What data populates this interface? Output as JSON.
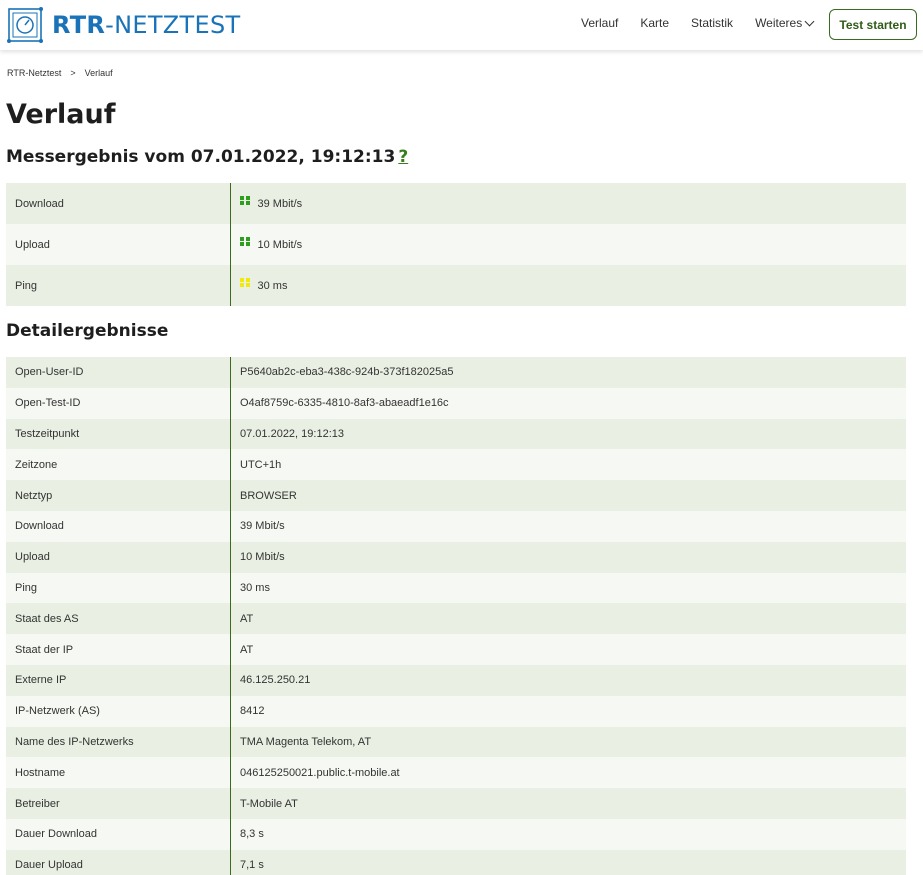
{
  "header": {
    "logo_bold": "RTR",
    "logo_rest": "-NETZTEST",
    "nav": [
      "Verlauf",
      "Karte",
      "Statistik",
      "Weiteres"
    ],
    "start_button": "Test starten"
  },
  "breadcrumb": {
    "home": "RTR-Netztest",
    "separator": ">",
    "current": "Verlauf"
  },
  "page_title": "Verlauf",
  "result_title": "Messergebnis vom 07.01.2022, 19:12:13",
  "help_label": "?",
  "summary": [
    {
      "label": "Download",
      "value": "39 Mbit/s",
      "color": "#2e9e1f"
    },
    {
      "label": "Upload",
      "value": "10 Mbit/s",
      "color": "#2e9e1f"
    },
    {
      "label": "Ping",
      "value": "30 ms",
      "color": "#f1e90b"
    }
  ],
  "detail_title": "Detailergebnisse",
  "details": [
    {
      "label": "Open-User-ID",
      "value": "P5640ab2c-eba3-438c-924b-373f182025a5"
    },
    {
      "label": "Open-Test-ID",
      "value": "O4af8759c-6335-4810-8af3-abaeadf1e16c"
    },
    {
      "label": "Testzeitpunkt",
      "value": "07.01.2022, 19:12:13"
    },
    {
      "label": "Zeitzone",
      "value": "UTC+1h"
    },
    {
      "label": "Netztyp",
      "value": "BROWSER"
    },
    {
      "label": "Download",
      "value": "39 Mbit/s"
    },
    {
      "label": "Upload",
      "value": "10 Mbit/s"
    },
    {
      "label": "Ping",
      "value": "30 ms"
    },
    {
      "label": "Staat des AS",
      "value": "AT"
    },
    {
      "label": "Staat der IP",
      "value": "AT"
    },
    {
      "label": "Externe IP",
      "value": "46.125.250.21"
    },
    {
      "label": "IP-Netzwerk (AS)",
      "value": "8412"
    },
    {
      "label": "Name des IP-Netzwerks",
      "value": "TMA Magenta Telekom, AT"
    },
    {
      "label": "Hostname",
      "value": "046125250021.public.t-mobile.at"
    },
    {
      "label": "Betreiber",
      "value": "T-Mobile AT"
    },
    {
      "label": "Dauer Download",
      "value": "8,3 s"
    },
    {
      "label": "Dauer Upload",
      "value": "7,1 s"
    }
  ]
}
